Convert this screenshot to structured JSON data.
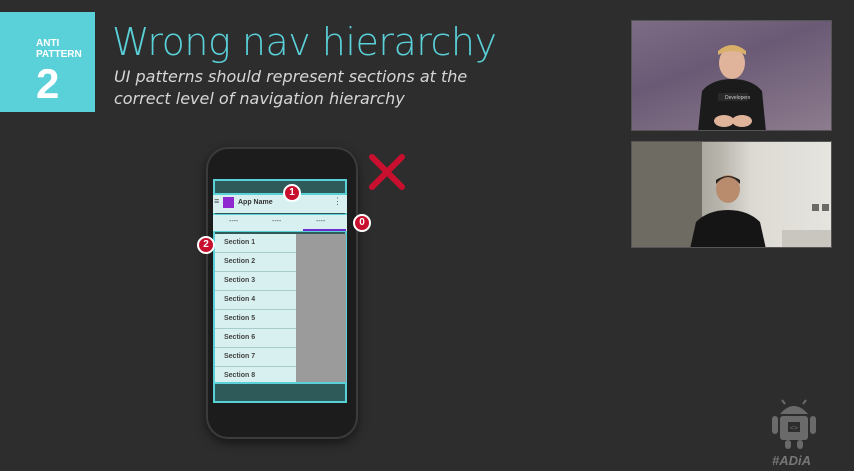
{
  "badge": {
    "line1": "ANTI",
    "line2": "PATTERN",
    "number": "2"
  },
  "title": "Wrong nav hierarchy",
  "subtitle": "UI patterns should represent sections at the correct level of navigation hierarchy",
  "phone": {
    "app_name": "App Name",
    "tabs": [
      "----",
      "----",
      "----"
    ],
    "sections": [
      "Section 1",
      "Section 2",
      "Section 3",
      "Section 4",
      "Section 5",
      "Section 6",
      "Section 7",
      "Section 8"
    ]
  },
  "markers": {
    "m1": "1",
    "m2": "2",
    "m0": "0"
  },
  "webcams": {
    "presenter_shirt_text": "Developers"
  },
  "hashtag": "#ADiA",
  "colors": {
    "accent": "#5ad0d8",
    "marker": "#c8102e",
    "x_mark": "#c8102e",
    "background": "#2d2d2d",
    "tab_indicator": "#6f2ad0",
    "app_icon": "#8e2ad0"
  }
}
